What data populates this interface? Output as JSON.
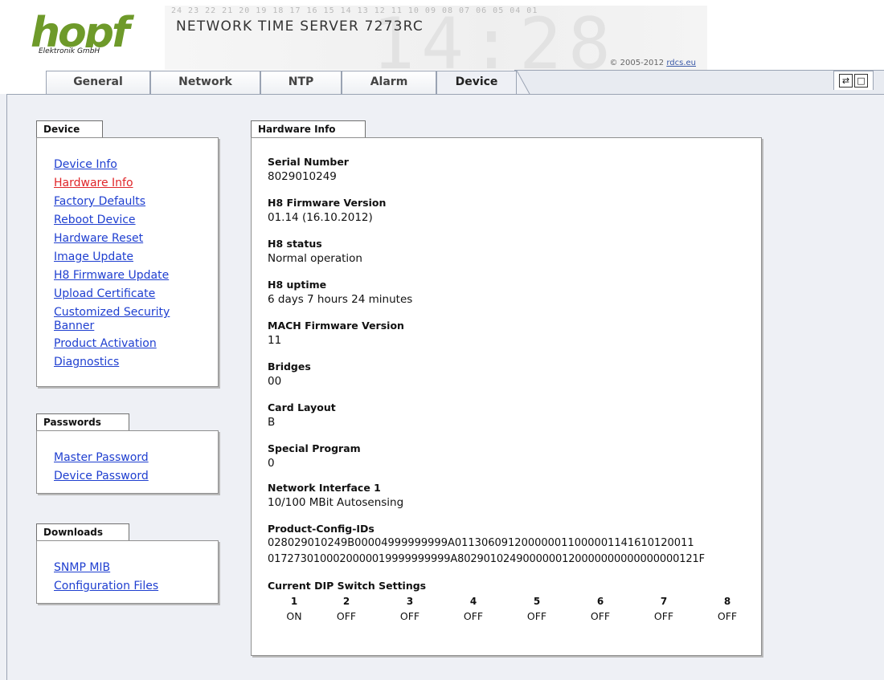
{
  "header": {
    "logo_text": "hopf",
    "logo_subtitle": "Elektronik GmbH",
    "banner_digits": "24 23 22 21 20 19 18 17 16 15 14 13 12 11 10 09 08 07 06 05 04 01",
    "banner_clock": "14:28",
    "title": "NETWORK TIME SERVER 7273RC",
    "copyright_prefix": "© 2005-2012",
    "copyright_link": "rdcs.eu"
  },
  "tabs": [
    {
      "label": "General"
    },
    {
      "label": "Network"
    },
    {
      "label": "NTP"
    },
    {
      "label": "Alarm"
    },
    {
      "label": "Device",
      "active": true
    }
  ],
  "toolbar_icons": [
    "refresh-toggle-icon",
    "page-icon"
  ],
  "sidebar": {
    "device": {
      "title": "Device",
      "links": [
        {
          "label": "Device Info"
        },
        {
          "label": "Hardware Info",
          "active": true
        },
        {
          "label": "Factory Defaults"
        },
        {
          "label": "Reboot Device"
        },
        {
          "label": "Hardware Reset"
        },
        {
          "label": "Image Update"
        },
        {
          "label": "H8 Firmware Update"
        },
        {
          "label": "Upload Certificate"
        },
        {
          "label": "Customized Security",
          "label2": "Banner"
        },
        {
          "label": "Product Activation"
        },
        {
          "label": "Diagnostics"
        }
      ]
    },
    "passwords": {
      "title": "Passwords",
      "links": [
        {
          "label": "Master Password"
        },
        {
          "label": "Device Password"
        }
      ]
    },
    "downloads": {
      "title": "Downloads",
      "links": [
        {
          "label": "SNMP MIB"
        },
        {
          "label": "Configuration Files"
        }
      ]
    }
  },
  "hardware_info": {
    "title": "Hardware Info",
    "items": [
      {
        "label": "Serial Number",
        "value": "8029010249"
      },
      {
        "label": "H8 Firmware Version",
        "value": "01.14 (16.10.2012)"
      },
      {
        "label": "H8 status",
        "value": "Normal operation"
      },
      {
        "label": "H8 uptime",
        "value": "6 days 7 hours 24 minutes"
      },
      {
        "label": "MACH Firmware Version",
        "value": "11"
      },
      {
        "label": "Bridges",
        "value": "00"
      },
      {
        "label": "Card Layout",
        "value": "B"
      },
      {
        "label": "Special Program",
        "value": "0"
      },
      {
        "label": "Network Interface 1",
        "value": "10/100 MBit Autosensing"
      }
    ],
    "config_ids": {
      "label": "Product-Config-IDs",
      "line1": "028029010249B00004999999999A011306091200000011000001141610120011",
      "line2": "0172730100020000019999999999A8029010249000000120000000000000000121F"
    },
    "dip": {
      "label": "Current DIP Switch Settings",
      "switches": [
        {
          "num": "1",
          "state": "ON"
        },
        {
          "num": "2",
          "state": "OFF"
        },
        {
          "num": "3",
          "state": "OFF"
        },
        {
          "num": "4",
          "state": "OFF"
        },
        {
          "num": "5",
          "state": "OFF"
        },
        {
          "num": "6",
          "state": "OFF"
        },
        {
          "num": "7",
          "state": "OFF"
        },
        {
          "num": "8",
          "state": "OFF"
        }
      ]
    }
  }
}
